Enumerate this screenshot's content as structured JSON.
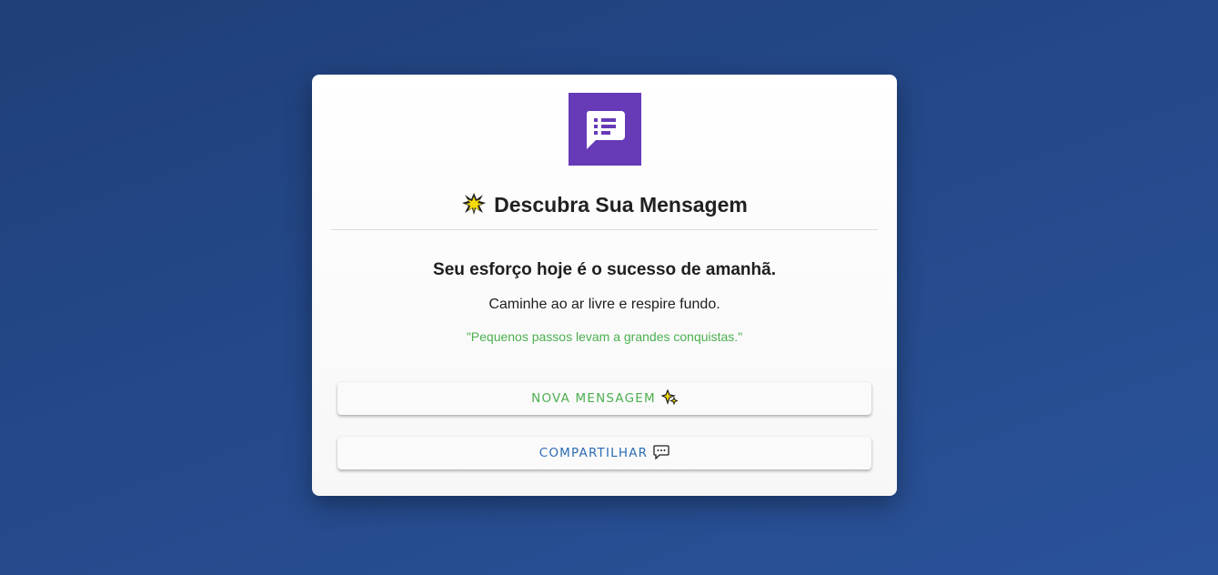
{
  "header": {
    "title": "Descubra Sua Mensagem"
  },
  "message": {
    "headline": "Seu esforço hoje é o sucesso de amanhã.",
    "suggestion": "Caminhe ao ar livre e respire fundo.",
    "quote": "\"Pequenos passos levam a grandes conquistas.\""
  },
  "buttons": {
    "new_label": "NOVA MENSAGEM",
    "share_label": "COMPARTILHAR"
  },
  "icons": {
    "app": "message-list-icon",
    "title": "glowing-star-icon",
    "new": "sparkles-icon",
    "share": "speech-bubble-icon"
  },
  "colors": {
    "app_icon_bg": "#673ab7",
    "quote": "#4caf50",
    "new_button_text": "#4caf50",
    "share_button_text": "#2d6db5"
  }
}
